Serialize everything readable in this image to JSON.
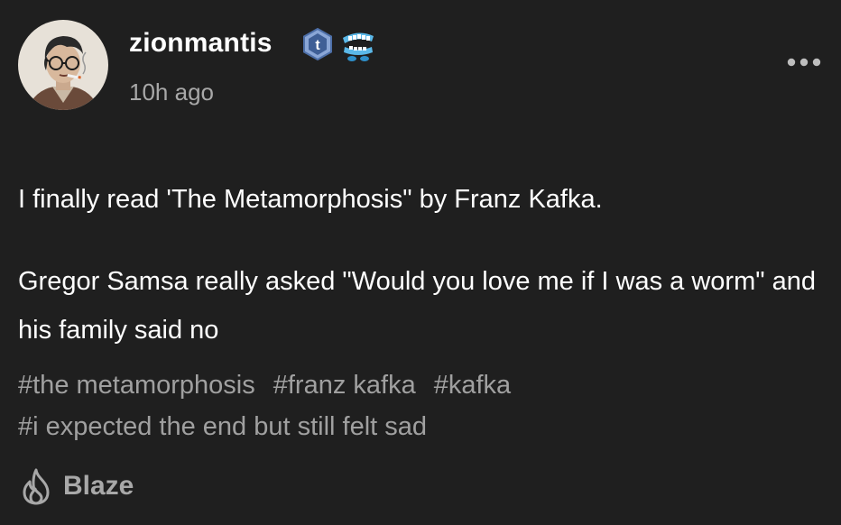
{
  "post": {
    "author": {
      "username": "zionmantis",
      "avatar_icon": "avatar-illustration-glasses-cigarette",
      "badges": [
        "tumblr-t-badge-icon",
        "chattering-teeth-badge-icon"
      ]
    },
    "timestamp": "10h ago",
    "menu_icon": "more-options-icon",
    "paragraphs": [
      "I finally read 'The Metamorphosis\" by Franz Kafka.",
      "Gregor Samsa really asked \"Would you love me if I was a worm\" and his family said no"
    ],
    "tags": [
      "#the metamorphosis",
      "#franz kafka",
      "#kafka",
      "#i expected the end but still felt sad"
    ],
    "blaze": {
      "icon": "flame-icon",
      "label": "Blaze"
    }
  },
  "colors": {
    "background": "#1f1f1f",
    "text_primary": "#ffffff",
    "text_secondary": "#a8a8a8",
    "tag_text": "#a0a0a0",
    "badge_blue": "#6f8fc4"
  }
}
